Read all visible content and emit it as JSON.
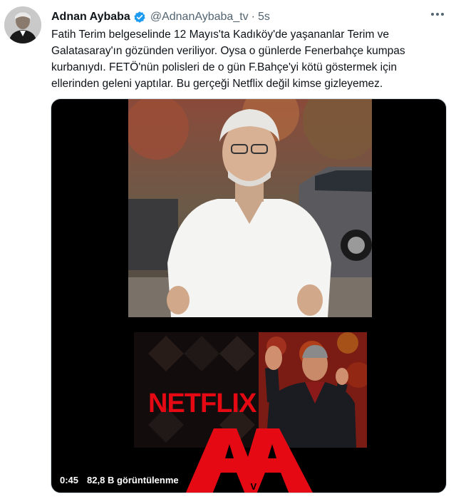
{
  "author": {
    "name": "Adnan Aybaba",
    "handle": "@AdnanAybaba_tv",
    "separator": "·",
    "time": "5s",
    "verified_icon": "verified-badge-icon"
  },
  "tweet": {
    "line1": "Fatih Terim belgeselinde 12 Mayıs'ta Kadıköy'de yaşananlar Terim ve",
    "line2": "Galatasaray'ın gözünden veriliyor. Oysa o günlerde Fenerbahçe kumpas",
    "line3": "kurbanıydı. FETÖ'nün polisleri de o gün F.Bahçe'yi kötü göstermek için",
    "line4": "ellerinden geleni yaptılar. Bu gerçeği Netflix değil kimse gizleyemez."
  },
  "video": {
    "duration": "0:45",
    "views": "82,8 B görüntülenme",
    "netflix_logo": "NETFLIX",
    "aa_logo": "AA",
    "aa_sub": "T V"
  },
  "colors": {
    "accent": "#1d9bf0",
    "netflix_red": "#e50914",
    "text": "#0f1419",
    "muted": "#536471"
  }
}
